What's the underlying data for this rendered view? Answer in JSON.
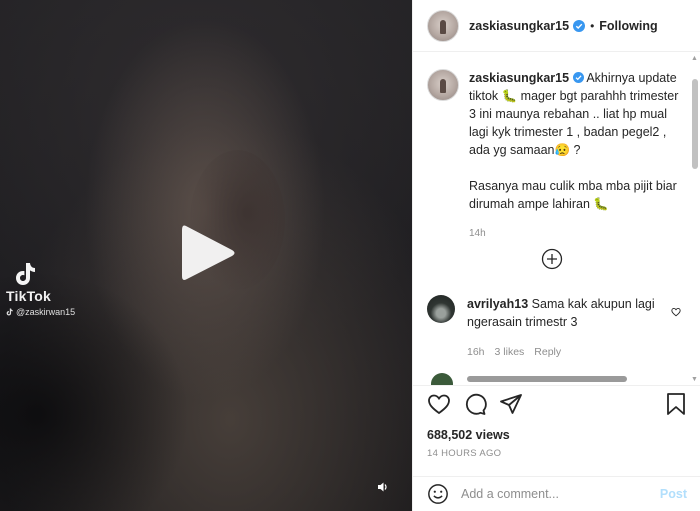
{
  "video": {
    "tiktok_brand": "TikTok",
    "tiktok_handle": "@zaskirwan15",
    "icons": {
      "play": "play-icon",
      "volume": "volume-icon",
      "tiktok": "tiktok-logo"
    }
  },
  "header": {
    "username": "zaskiasungkar15",
    "separator": "•",
    "follow_label": "Following",
    "verified_color": "#3897f0"
  },
  "caption": {
    "username": "zaskiasungkar15",
    "text": "Akhirnya update tiktok 🐛 mager bgt parahhh trimester 3 ini maunya rebahan .. liat hp mual lagi kyk trimester 1 , badan pegel2 , ada yg samaan😥 ?",
    "text2": "Rasanya mau culik mba mba pijit biar dirumah ampe lahiran 🐛",
    "time": "14h"
  },
  "comments": [
    {
      "username": "avrilyah13",
      "text": "Sama kak akupun lagi ngerasain trimestr 3",
      "time": "16h",
      "likes": "3 likes",
      "reply": "Reply"
    }
  ],
  "actions": {
    "views": "688,502 views",
    "posted_ago": "14 HOURS AGO"
  },
  "add_comment": {
    "placeholder": "Add a comment...",
    "post_label": "Post",
    "post_color": "#b2dffc"
  }
}
